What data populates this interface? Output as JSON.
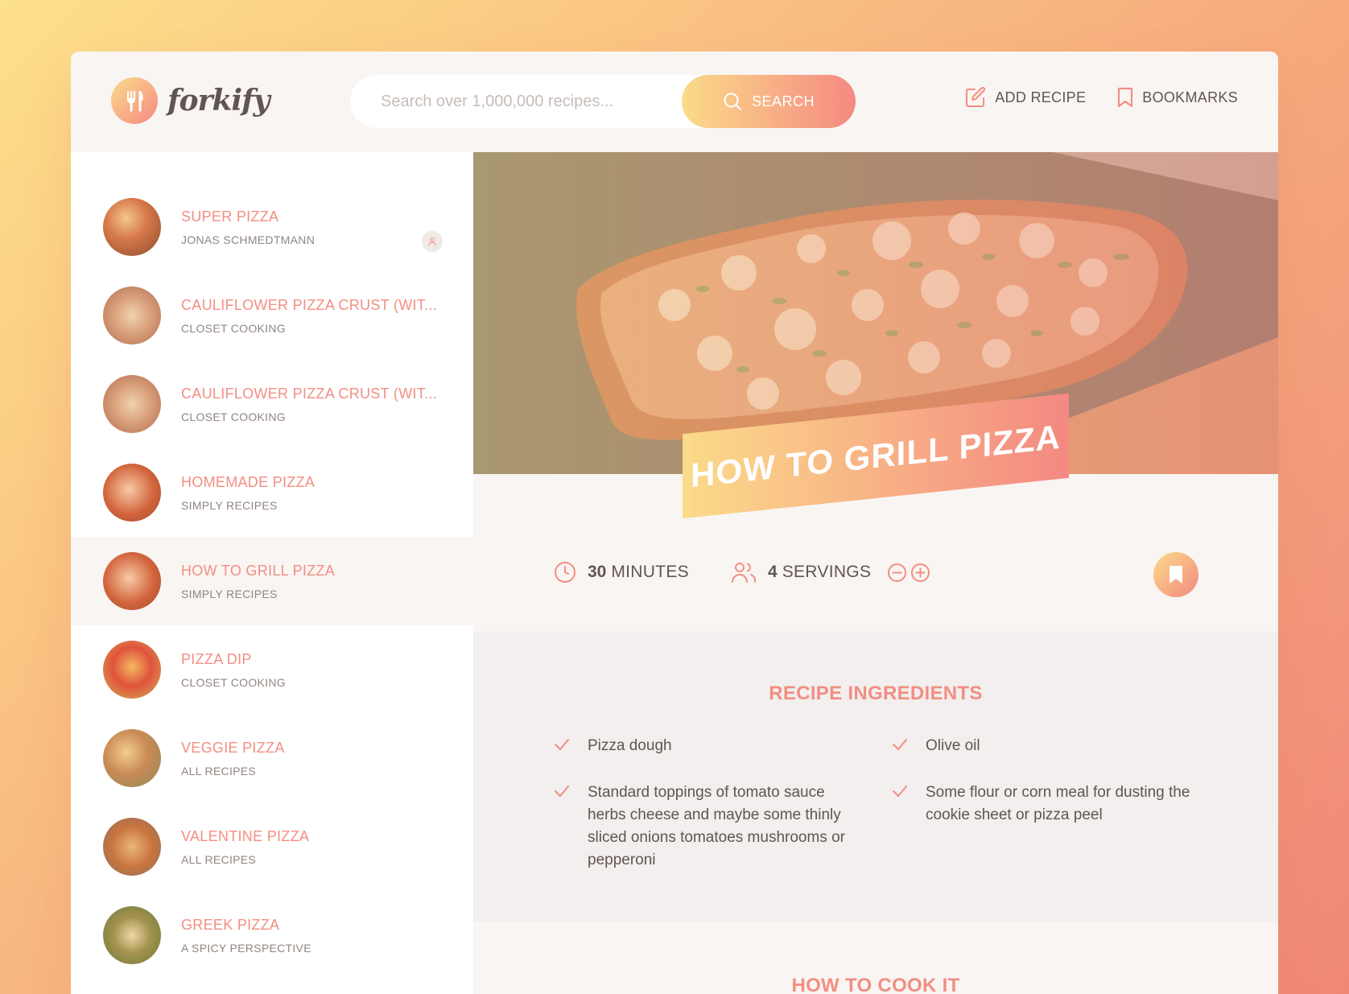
{
  "header": {
    "logo_text": "forkify",
    "search": {
      "placeholder": "Search over 1,000,000 recipes...",
      "button_label": "SEARCH"
    },
    "nav": {
      "add_recipe": "ADD RECIPE",
      "bookmarks": "BOOKMARKS"
    }
  },
  "results": [
    {
      "title": "SUPER PIZZA",
      "publisher": "JONAS SCHMEDTMANN",
      "user_generated": true
    },
    {
      "title": "CAULIFLOWER PIZZA CRUST (WIT...",
      "publisher": "CLOSET COOKING"
    },
    {
      "title": "CAULIFLOWER PIZZA CRUST (WIT...",
      "publisher": "CLOSET COOKING"
    },
    {
      "title": "HOMEMADE PIZZA",
      "publisher": "SIMPLY RECIPES"
    },
    {
      "title": "HOW TO GRILL PIZZA",
      "publisher": "SIMPLY RECIPES",
      "active": true
    },
    {
      "title": "PIZZA DIP",
      "publisher": "CLOSET COOKING"
    },
    {
      "title": "VEGGIE PIZZA",
      "publisher": "ALL RECIPES"
    },
    {
      "title": "VALENTINE PIZZA",
      "publisher": "ALL RECIPES"
    },
    {
      "title": "GREEK PIZZA",
      "publisher": "A SPICY PERSPECTIVE"
    }
  ],
  "recipe": {
    "title": "HOW TO GRILL PIZZA",
    "cooking_time": "30",
    "cooking_time_unit": "MINUTES",
    "servings": "4",
    "servings_unit": "SERVINGS",
    "ingredients_heading": "RECIPE INGREDIENTS",
    "ingredients": [
      "Pizza dough",
      "Olive oil",
      "Standard toppings of tomato sauce herbs cheese and maybe some thinly sliced onions tomatoes mushrooms or pepperoni",
      "Some flour or corn meal for dusting the cookie sheet or pizza peel"
    ],
    "directions_heading": "HOW TO COOK IT"
  },
  "colors": {
    "accent": "#f38e82",
    "gradient_start": "#fbdb89",
    "gradient_end": "#f48982",
    "text": "#615551"
  }
}
